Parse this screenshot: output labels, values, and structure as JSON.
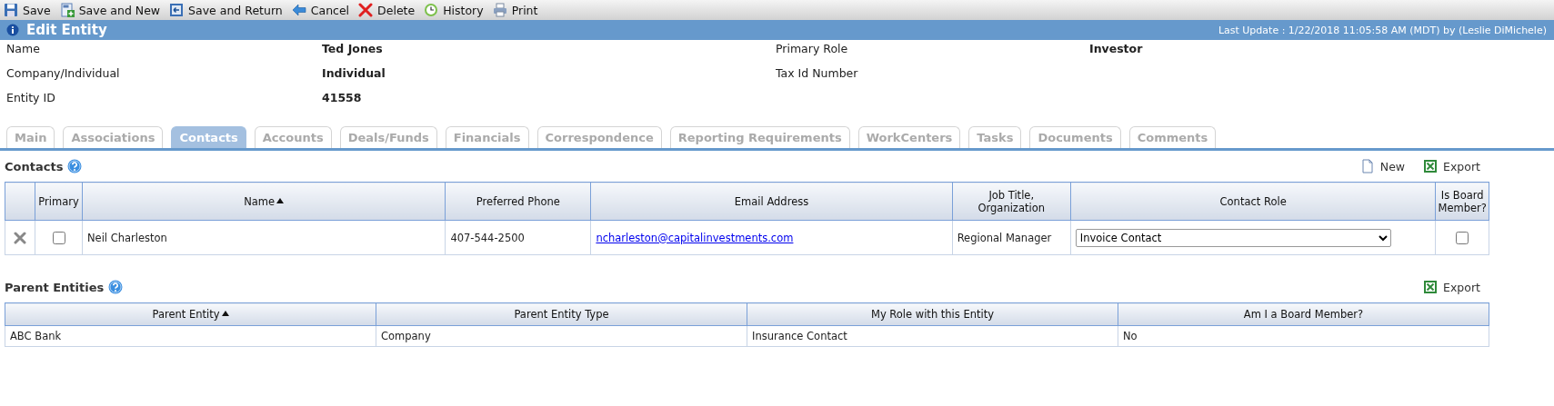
{
  "toolbar": [
    {
      "label": "Save",
      "kind": "save"
    },
    {
      "label": "Save and New",
      "kind": "save-new"
    },
    {
      "label": "Save and Return",
      "kind": "save-return"
    },
    {
      "label": "Cancel",
      "kind": "cancel"
    },
    {
      "label": "Delete",
      "kind": "delete"
    },
    {
      "label": "History",
      "kind": "history"
    },
    {
      "label": "Print",
      "kind": "print"
    }
  ],
  "header": {
    "title": "Edit Entity",
    "last_update": "Last Update : 1/22/2018 11:05:58 AM (MDT) by (Leslie DiMichele)"
  },
  "fields": [
    {
      "label": "Name",
      "value": "Ted Jones"
    },
    {
      "label": "Primary Role",
      "value": "Investor"
    },
    {
      "label": "Company/Individual",
      "value": "Individual"
    },
    {
      "label": "Tax Id Number"
    },
    {
      "label": "Entity ID",
      "value": "41558"
    }
  ],
  "tabs": [
    {
      "label": "Main",
      "selected": false
    },
    {
      "label": "Associations",
      "selected": false
    },
    {
      "label": "Contacts",
      "selected": true
    },
    {
      "label": "Accounts",
      "selected": false
    },
    {
      "label": "Deals/Funds",
      "selected": false
    },
    {
      "label": "Financials",
      "selected": false
    },
    {
      "label": "Correspondence",
      "selected": false
    },
    {
      "label": "Reporting Requirements",
      "selected": false
    },
    {
      "label": "WorkCenters",
      "selected": false
    },
    {
      "label": "Tasks",
      "selected": false
    },
    {
      "label": "Documents",
      "selected": false
    },
    {
      "label": "Comments",
      "selected": false
    }
  ],
  "contacts": {
    "title": "Contacts",
    "actions": [
      {
        "label": "New",
        "kind": "new"
      },
      {
        "label": "Export",
        "kind": "export"
      }
    ],
    "columns": [
      {
        "label": "Primary",
        "sorted": false
      },
      {
        "label": "Name",
        "sorted": true
      },
      {
        "label": "Preferred Phone",
        "sorted": false
      },
      {
        "label": "Email Address",
        "sorted": false
      },
      {
        "label": "Job Title, Organization",
        "sorted": false
      },
      {
        "label": "Contact Role",
        "sorted": false
      },
      {
        "label": "Is Board Member?",
        "sorted": false
      }
    ],
    "rows": [
      {
        "primary": false,
        "name": "Neil Charleston",
        "phone": "407-544-2500",
        "email": "ncharleston@capitalinvestments.com",
        "job_title": "Regional Manager",
        "contact_role": "Invoice Contact",
        "board_member": false
      }
    ]
  },
  "parent_entities": {
    "title": "Parent Entities",
    "actions": [
      {
        "label": "Export",
        "kind": "export"
      }
    ],
    "columns": [
      {
        "label": "Parent Entity",
        "sorted": true
      },
      {
        "label": "Parent Entity Type",
        "sorted": false
      },
      {
        "label": "My Role with this Entity",
        "sorted": false
      },
      {
        "label": "Am I a Board Member?",
        "sorted": false
      }
    ],
    "rows": [
      {
        "cells": [
          "ABC Bank",
          "Company",
          "Insurance Contact",
          "No"
        ]
      }
    ]
  }
}
